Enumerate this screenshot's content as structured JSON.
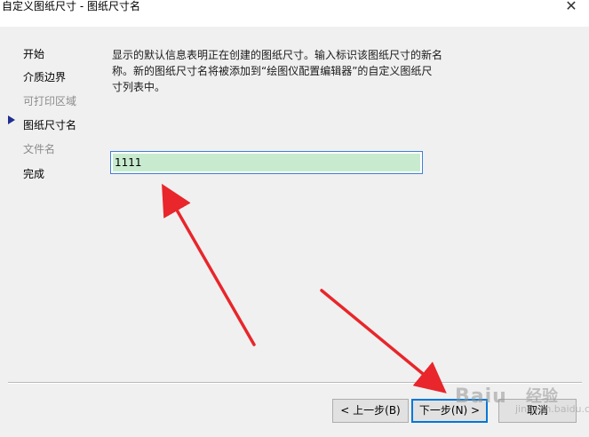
{
  "window": {
    "title": "自定义图纸尺寸 - 图纸尺寸名",
    "close_label": "✕"
  },
  "nav": {
    "items": [
      {
        "label": "开始",
        "state": "active"
      },
      {
        "label": "介质边界",
        "state": "active"
      },
      {
        "label": "可打印区域",
        "state": "disabled"
      },
      {
        "label": "图纸尺寸名",
        "state": "current"
      },
      {
        "label": "文件名",
        "state": "disabled"
      },
      {
        "label": "完成",
        "state": "active"
      }
    ],
    "current_index": 3
  },
  "main": {
    "description": "显示的默认信息表明正在创建的图纸尺寸。输入标识该图纸尺寸的新名称。新的图纸尺寸名将被添加到“绘图仪配置编辑器”的自定义图纸尺寸列表中。",
    "paper_size_name_value": "1111"
  },
  "buttons": {
    "back_label": "< 上一步(B)",
    "next_label": "下一步(N) >",
    "cancel_label": "取消"
  },
  "watermark": {
    "brand": "Baiu",
    "sub": "经验",
    "url": "jingyan.baidu.com"
  },
  "colors": {
    "window_bg": "#f0f0f0",
    "input_highlight": "#c8ebcf",
    "focus_border": "#0078d7",
    "annotation_arrow": "#e8262b",
    "nav_pointer": "#1f2e8f"
  }
}
